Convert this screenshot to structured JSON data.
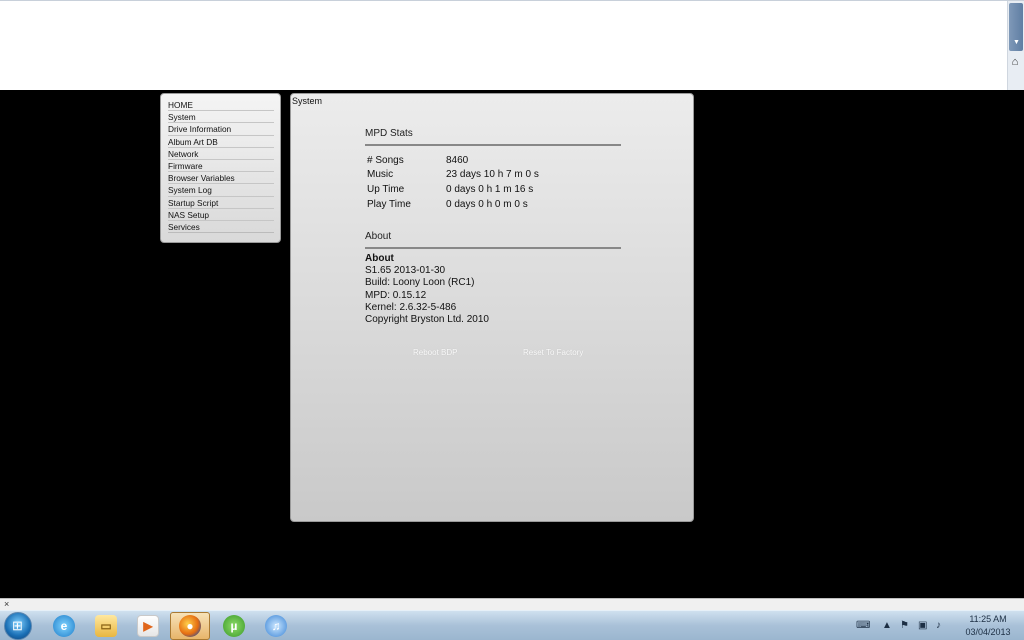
{
  "sidebar": {
    "items": [
      {
        "label": "HOME"
      },
      {
        "label": "System"
      },
      {
        "label": "Drive Information"
      },
      {
        "label": "Album Art DB"
      },
      {
        "label": "Network"
      },
      {
        "label": "Firmware"
      },
      {
        "label": "Browser Variables"
      },
      {
        "label": "System Log"
      },
      {
        "label": "Startup Script"
      },
      {
        "label": "NAS Setup"
      },
      {
        "label": "Services"
      }
    ]
  },
  "main": {
    "title": "System",
    "stats": {
      "title": "MPD Stats",
      "rows": [
        {
          "key": "# Songs",
          "value": "8460"
        },
        {
          "key": "Music",
          "value": "23 days 10 h 7 m 0 s"
        },
        {
          "key": "Up Time",
          "value": "0 days 0 h 1 m 16 s"
        },
        {
          "key": "Play Time",
          "value": "0 days 0 h 0 m 0 s"
        }
      ]
    },
    "about": {
      "title": "About",
      "heading": "About",
      "lines": [
        "S1.65 2013-01-30",
        "Build: Loony Loon (RC1)",
        "MPD: 0.15.12",
        "Kernel: 2.6.32-5-486",
        "Copyright Bryston Ltd. 2010"
      ]
    },
    "buttons": {
      "reboot_label": "Reboot BDP",
      "reset_label": "Reset To Factory"
    }
  },
  "taskbar": {
    "clock_time": "11:25 AM",
    "clock_date": "03/04/2013",
    "apps": [
      {
        "icon": "internet-explorer-icon",
        "glyph": "e"
      },
      {
        "icon": "windows-explorer-icon",
        "glyph": "▭"
      },
      {
        "icon": "media-player-icon",
        "glyph": "▶"
      },
      {
        "icon": "firefox-icon",
        "glyph": "●"
      },
      {
        "icon": "utorrent-icon",
        "glyph": "µ"
      },
      {
        "icon": "itunes-icon",
        "glyph": "♫"
      }
    ]
  },
  "colors": {
    "page_background": "#000000",
    "panel_background": "#e2e2e2",
    "taskbar_blue": "#a9c1d8",
    "active_task_orange": "#e7b56a"
  }
}
